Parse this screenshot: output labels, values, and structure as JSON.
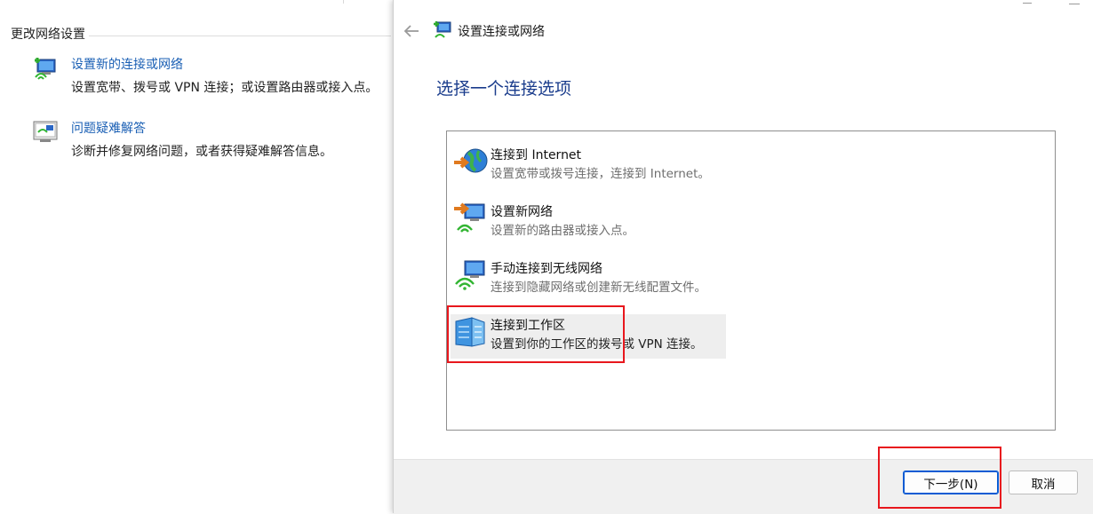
{
  "background_panel": {
    "heading": "更改网络设置",
    "items": [
      {
        "title": "设置新的连接或网络",
        "description": "设置宽带、拨号或 VPN 连接；或设置路由器或接入点。",
        "icon": "network-setup-icon"
      },
      {
        "title": "问题疑难解答",
        "description": "诊断并修复网络问题，或者获得疑难解答信息。",
        "icon": "troubleshoot-icon"
      }
    ]
  },
  "wizard": {
    "title": "设置连接或网络",
    "heading": "选择一个连接选项",
    "options": [
      {
        "title": "连接到 Internet",
        "description": "设置宽带或拨号连接，连接到 Internet。",
        "icon": "globe-internet-icon"
      },
      {
        "title": "设置新网络",
        "description": "设置新的路由器或接入点。",
        "icon": "new-network-icon"
      },
      {
        "title": "手动连接到无线网络",
        "description": "连接到隐藏网络或创建新无线配置文件。",
        "icon": "wireless-network-icon"
      },
      {
        "title": "连接到工作区",
        "description": "设置到你的工作区的拨号或 VPN 连接。",
        "icon": "workplace-building-icon",
        "selected": true
      }
    ],
    "buttons": {
      "next": "下一步(N)",
      "cancel": "取消"
    }
  },
  "colors": {
    "accent": "#1a3c8c",
    "link": "#1a5fb4",
    "highlight": "#e8171d",
    "primary_border": "#0a5bd3"
  }
}
